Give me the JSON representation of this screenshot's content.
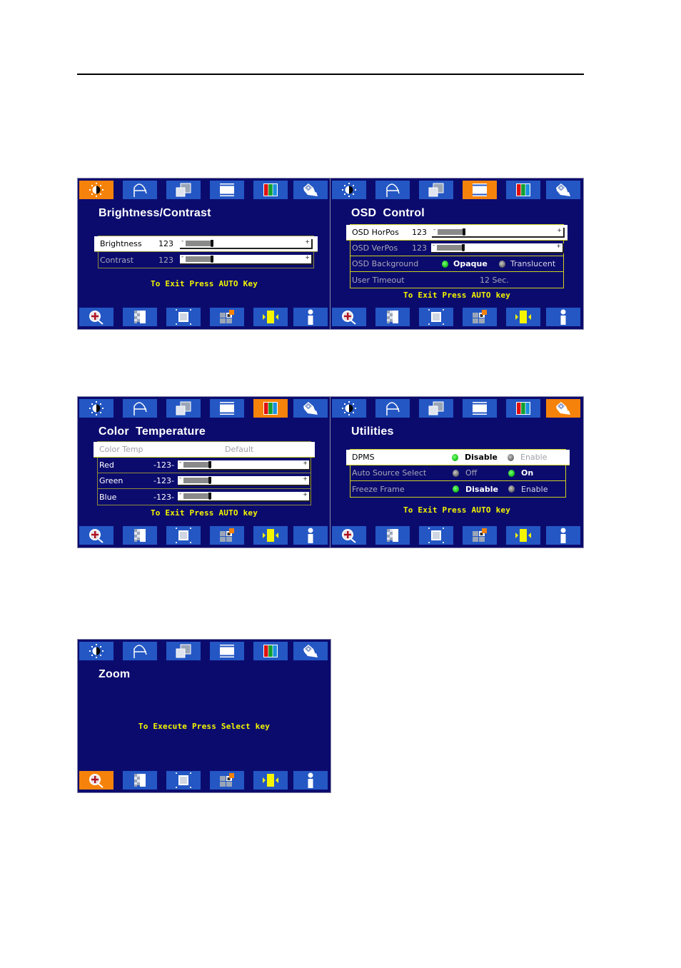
{
  "document": {
    "top_rule": true
  },
  "menu_icons_top": [
    {
      "name": "brightness-icon"
    },
    {
      "name": "image-setup-icon"
    },
    {
      "name": "image-properties-icon"
    },
    {
      "name": "osd-control-icon"
    },
    {
      "name": "color-temperature-icon"
    },
    {
      "name": "utilities-icon"
    }
  ],
  "menu_icons_bottom": [
    {
      "name": "zoom-icon"
    },
    {
      "name": "sharpness-icon"
    },
    {
      "name": "image-size-icon"
    },
    {
      "name": "pip-icon"
    },
    {
      "name": "input-source-icon"
    },
    {
      "name": "information-icon"
    }
  ],
  "colors": {
    "osd_background": "#0b0b6e",
    "tab_inactive": "#2457c4",
    "tab_active": "#f5820a",
    "hint_text": "#f5f500",
    "radio_selected": "#1ec81e",
    "radio_unselected": "#707070"
  },
  "panels": {
    "brightness_contrast": {
      "title": "Brightness/Contrast",
      "active_tab": "brightness-icon",
      "rows": [
        {
          "label": "Brightness",
          "value": "123",
          "slider_fraction": 0.22,
          "selected": true
        },
        {
          "label": "Contrast",
          "value": "123",
          "slider_fraction": 0.22,
          "selected": false
        }
      ],
      "hint": "To Exit Press AUTO Key"
    },
    "osd_control": {
      "title": "OSD  Control",
      "active_tab": "osd-control-icon",
      "rows": [
        {
          "label": "OSD HorPos",
          "value": "123",
          "slider_fraction": 0.22,
          "selected": true
        },
        {
          "label": "OSD VerPos",
          "value": "123",
          "slider_fraction": 0.22,
          "selected": false
        }
      ],
      "background": {
        "label": "OSD Background",
        "options": [
          "Opaque",
          "Translucent"
        ],
        "selected": "Opaque"
      },
      "timeout": {
        "label": "User Timeout",
        "value": "12 Sec."
      },
      "hint": "To Exit Press AUTO key"
    },
    "color_temperature": {
      "title": "Color  Temperature",
      "active_tab": "color-temperature-icon",
      "color_temp": {
        "label": "Color Temp",
        "value": "Default"
      },
      "rows": [
        {
          "label": "Red",
          "value": "-123-",
          "slider_fraction": 0.22
        },
        {
          "label": "Green",
          "value": "-123-",
          "slider_fraction": 0.22
        },
        {
          "label": "Blue",
          "value": "-123-",
          "slider_fraction": 0.22
        }
      ],
      "hint": "To Exit Press AUTO key"
    },
    "utilities": {
      "title": "Utilities",
      "active_tab": "utilities-icon",
      "rows": [
        {
          "label": "DPMS",
          "options": [
            "Disable",
            "Enable"
          ],
          "selected": "Disable"
        },
        {
          "label": "Auto Source Select",
          "options": [
            "Off",
            "On"
          ],
          "selected": "On"
        },
        {
          "label": "Freeze Frame",
          "options": [
            "Disable",
            "Enable"
          ],
          "selected": "Disable"
        }
      ],
      "hint": "To Exit Press AUTO key"
    },
    "zoom": {
      "title": "Zoom",
      "active_tab": "zoom-icon",
      "hint": "To Execute Press Select key"
    }
  },
  "slider_glyphs": {
    "minus": "-",
    "plus": "+"
  }
}
